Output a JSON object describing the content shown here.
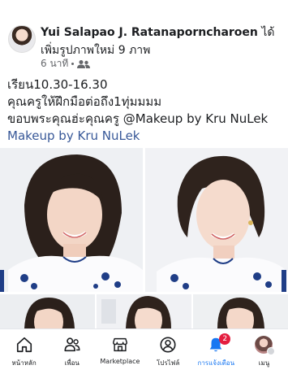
{
  "post": {
    "author_name": "Yui Salapao J. Ratanaporncharoen",
    "author_suffix": " ได้",
    "action": "เพิ่มรูปภาพใหม่ 9 ภาพ",
    "time": "6 นาที",
    "audience_icon": "friends-icon",
    "text_lines": [
      "เรียน10.30-16.30",
      "คุณครูให้ฝึกมือต่อถึง1ทุ่มมมม",
      "ขอบพระคุณฮ่ะคุณครู @Makeup by Kru NuLek"
    ],
    "tag_link": "Makeup by Kru NuLek",
    "photo_count": 9
  },
  "tabbar": {
    "tabs": [
      {
        "label": "หน้าหลัก",
        "icon": "home-icon"
      },
      {
        "label": "เพื่อน",
        "icon": "friends-icon"
      },
      {
        "label": "Marketplace",
        "icon": "marketplace-icon"
      },
      {
        "label": "โปรไฟล์",
        "icon": "profile-icon"
      },
      {
        "label": "การแจ้งเตือน",
        "icon": "bell-icon",
        "badge": "2",
        "active": true
      },
      {
        "label": "เมนู",
        "icon": "menu-avatar"
      }
    ]
  },
  "colors": {
    "accent": "#1877f2",
    "link": "#385898",
    "badge": "#e41e3f"
  }
}
